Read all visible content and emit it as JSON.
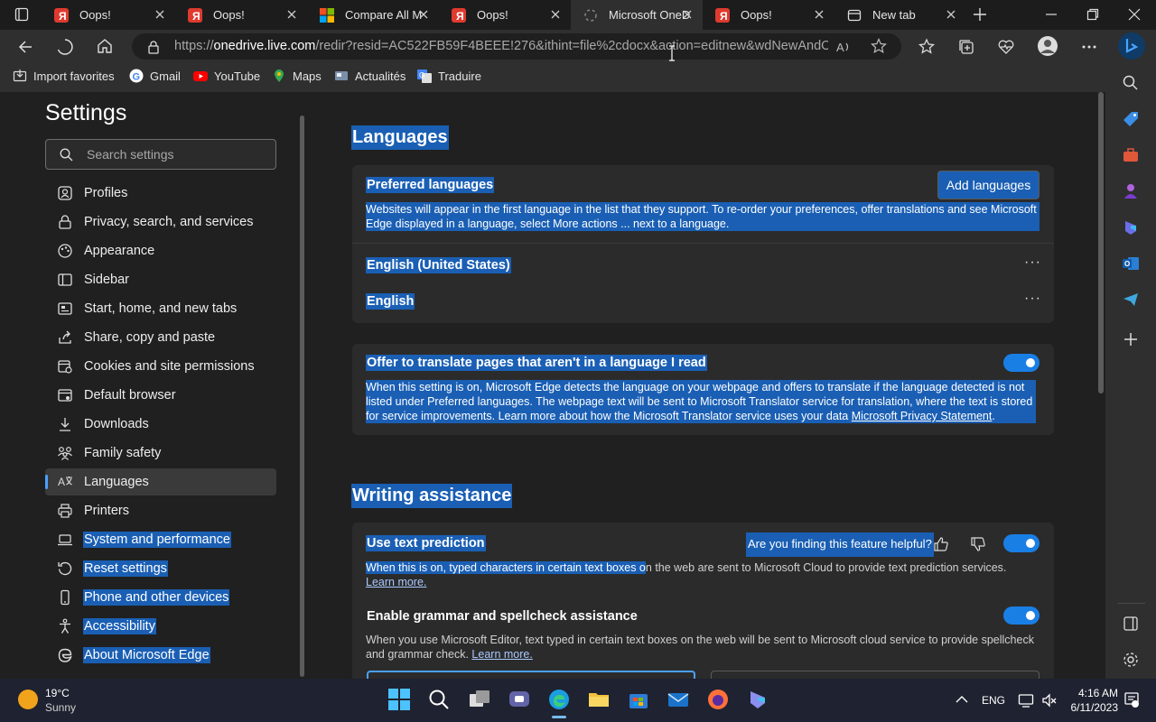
{
  "tabs": [
    {
      "title": "Oops!",
      "favicon": "yandex-icon"
    },
    {
      "title": "Oops!",
      "favicon": "yandex-icon"
    },
    {
      "title": "Compare All M",
      "favicon": "microsoft-icon"
    },
    {
      "title": "Oops!",
      "favicon": "yandex-icon"
    },
    {
      "title": "Microsoft OneD",
      "favicon": "loading-icon",
      "active": true
    },
    {
      "title": "Oops!",
      "favicon": "yandex-icon"
    },
    {
      "title": "New tab",
      "favicon": "newtab-icon"
    }
  ],
  "address": {
    "prefix": "https://",
    "host": "onedrive.live.com",
    "path": "/redir?resid=AC522FB59F4BEEE!276&ithint=file%2cdocx&action=editnew&wdNewAndOp..."
  },
  "bookmarks": [
    {
      "label": "Import favorites",
      "icon": "import-icon"
    },
    {
      "label": "Gmail",
      "icon": "google-icon"
    },
    {
      "label": "YouTube",
      "icon": "youtube-icon"
    },
    {
      "label": "Maps",
      "icon": "maps-pin-icon"
    },
    {
      "label": "Actualités",
      "icon": "news-icon"
    },
    {
      "label": "Traduire",
      "icon": "translate-icon"
    }
  ],
  "settings": {
    "title": "Settings",
    "search_placeholder": "Search settings",
    "nav": [
      {
        "label": "Profiles",
        "icon": "profile-icon"
      },
      {
        "label": "Privacy, search, and services",
        "icon": "lock-icon"
      },
      {
        "label": "Appearance",
        "icon": "appearance-icon"
      },
      {
        "label": "Sidebar",
        "icon": "sidebar-icon"
      },
      {
        "label": "Start, home, and new tabs",
        "icon": "home-icon"
      },
      {
        "label": "Share, copy and paste",
        "icon": "share-icon"
      },
      {
        "label": "Cookies and site permissions",
        "icon": "cookies-icon"
      },
      {
        "label": "Default browser",
        "icon": "browser-icon"
      },
      {
        "label": "Downloads",
        "icon": "download-icon"
      },
      {
        "label": "Family safety",
        "icon": "family-icon"
      },
      {
        "label": "Languages",
        "icon": "languages-icon",
        "active": true
      },
      {
        "label": "Printers",
        "icon": "printer-icon"
      },
      {
        "label": "System and performance",
        "icon": "laptop-icon",
        "selected": true
      },
      {
        "label": "Reset settings",
        "icon": "reset-icon",
        "selected": true
      },
      {
        "label": "Phone and other devices",
        "icon": "phone-icon",
        "selected": true
      },
      {
        "label": "Accessibility",
        "icon": "accessibility-icon",
        "selected": true
      },
      {
        "label": "About Microsoft Edge",
        "icon": "edge-icon",
        "selected": true
      }
    ]
  },
  "languages": {
    "heading": "Languages",
    "preferred_title": "Preferred languages",
    "add_button": "Add languages",
    "preferred_desc": "Websites will appear in the first language in the list that they support. To re-order your preferences, offer translations and see Microsoft Edge displayed in a language, select More actions ... next to a language.",
    "list": [
      "English (United States)",
      "English"
    ],
    "more_actions": "···",
    "translate_title": "Offer to translate pages that aren't in a language I read",
    "translate_desc": "When this setting is on, Microsoft Edge detects the language on your webpage and offers to translate if the language detected is not listed under Preferred languages. The webpage text will be sent to Microsoft Translator service for translation, where the text is stored for service improvements. Learn more about how the Microsoft Translator service uses your data",
    "privacy_link": "Microsoft Privacy Statement",
    "translate_on": true
  },
  "writing": {
    "heading": "Writing assistance",
    "prediction_title": "Use text prediction",
    "feedback_prompt": "Are you finding this feature helpful?",
    "prediction_desc_selected": "When this is on, typed characters in certain text boxes o",
    "prediction_desc_rest": "n the web are sent to Microsoft Cloud to provide text prediction services.",
    "learn_more_1": "Learn more.",
    "grammar_title": "Enable grammar and spellcheck assistance",
    "grammar_desc": "When you use Microsoft Editor, text typed in certain text boxes on the web will be sent to Microsoft cloud service to provide spellcheck and grammar check.",
    "learn_more_2": "Learn more.",
    "prediction_on": true,
    "grammar_on": true
  },
  "taskbar": {
    "weather_temp": "19°C",
    "weather_desc": "Sunny",
    "language": "ENG",
    "time": "4:16 AM",
    "date": "6/11/2023"
  }
}
